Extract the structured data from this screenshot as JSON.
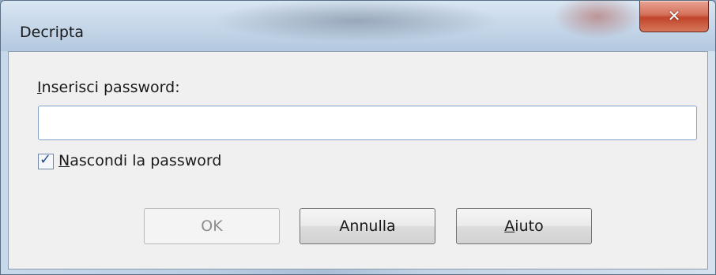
{
  "window": {
    "title": "Decripta",
    "close_icon": "close-icon"
  },
  "form": {
    "password_label_accel": "I",
    "password_label_rest": "nserisci password:",
    "password_value": "",
    "hide_password_checked": true,
    "hide_password_accel": "N",
    "hide_password_rest": "ascondi la password"
  },
  "buttons": {
    "ok": "OK",
    "cancel": "Annulla",
    "help_accel": "A",
    "help_rest": "iuto"
  },
  "colors": {
    "close_button": "#c7462c",
    "input_border": "#7fa2c8",
    "dialog_bg": "#f0f0f0"
  }
}
